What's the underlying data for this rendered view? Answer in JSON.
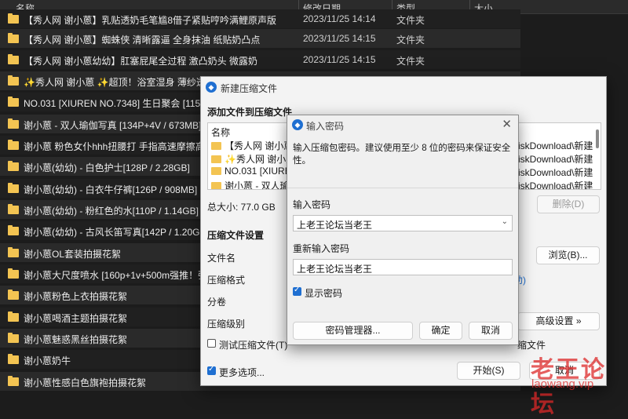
{
  "list_header": {
    "name": "名称",
    "date": "修改日期",
    "type": "类型",
    "size": "大小"
  },
  "files": [
    {
      "name": "【秀人网 谢小蒽】乳贴透奶毛笔尴8借子紧贴哼吟满鲤原声版",
      "date": "2023/11/25 14:14",
      "type": "文件夹"
    },
    {
      "name": "【秀人网 谢小蒽】蜘蛛侠 清晰露逼 全身抹油 纸贴奶凸点",
      "date": "2023/11/25 14:15",
      "type": "文件夹"
    },
    {
      "name": "【秀人网 谢小蒽幼幼】肛塞屁尾全过程 激凸奶头 微露奶",
      "date": "2023/11/25 14:15",
      "type": "文件夹"
    },
    {
      "name": "✨秀人网 谢小蒽 ✨超顶！浴室湿身 薄纱透点 勒出",
      "date": "",
      "type": ""
    },
    {
      "name": "NO.031 [XIUREN NO.7348] 生日聚会 [115P+4V]",
      "date": "",
      "type": ""
    },
    {
      "name": "谢小蒽 - 双人瑜伽写真 [134P+4V / 673MB]",
      "date": "",
      "type": ""
    },
    {
      "name": "谢小蒽 粉色女仆hhh扭腰打 手指高速摩擦高潮喷水 [3",
      "date": "",
      "type": ""
    },
    {
      "name": "谢小蒽(幼幼) - 白色护士[128P / 2.28GB]",
      "date": "",
      "type": ""
    },
    {
      "name": "谢小蒽(幼幼) - 白衣牛仔裤[126P / 908MB]",
      "date": "",
      "type": ""
    },
    {
      "name": "谢小蒽(幼幼) - 粉红色的水[110P / 1.14GB]",
      "date": "",
      "type": ""
    },
    {
      "name": "谢小蒽(幼幼) - 古风长笛写真[142P / 1.20GB]",
      "date": "",
      "type": ""
    },
    {
      "name": "谢小蒽OL套装拍摄花絮",
      "date": "",
      "type": ""
    },
    {
      "name": "谢小蒽大尺度喷水 [160p+1v+500m强推！强推！",
      "date": "",
      "type": ""
    },
    {
      "name": "谢小蒽粉色上衣拍摄花絮",
      "date": "",
      "type": ""
    },
    {
      "name": "谢小蒽喝酒主题拍摄花絮",
      "date": "",
      "type": ""
    },
    {
      "name": "谢小蒽魅惑黑丝拍摄花絮",
      "date": "",
      "type": ""
    },
    {
      "name": "谢小蒽奶牛",
      "date": "",
      "type": ""
    },
    {
      "name": "谢小蒽性感白色旗袍拍摄花絮",
      "date": "",
      "type": ""
    }
  ],
  "archive_dialog": {
    "title": "新建压缩文件",
    "add_section": "添加文件到压缩文件",
    "col_name": "名称",
    "items": [
      {
        "name": "【秀人网 谢小蒽幼",
        "path": "iskDownload\\新建"
      },
      {
        "name": "✨秀人网 谢小蒽 ✨",
        "path": "iskDownload\\新建"
      },
      {
        "name": "NO.031 [XIUREN I",
        "path": "iskDownload\\新建"
      },
      {
        "name": "谢小蒽 - 双人瑜",
        "path": "iskDownload\\新建"
      }
    ],
    "total_size": "总大小: 77.0 GB",
    "delete_label": "删除(D)",
    "settings_section": "压缩文件设置",
    "filename_label": "文件名",
    "browse_label": "浏览(B)...",
    "format_label": "压缩格式",
    "format_link_fragment": "助)",
    "split_label": "分卷",
    "level_label": "压缩级别",
    "advanced_label": "高级设置 »",
    "test_label": "测试压缩文件(T)",
    "right_fragment": "缩文件",
    "more_options_label": "更多选项...",
    "start_label": "开始(S)",
    "cancel_label": "取消"
  },
  "password_dialog": {
    "title": "输入密码",
    "description": "输入压缩包密码。建议使用至少 8 位的密码来保证安全性。",
    "enter_label": "输入密码",
    "password_value": "上老王论坛当老王",
    "reenter_label": "重新输入密码",
    "reenter_value": "上老王论坛当老王",
    "show_password_label": "显示密码",
    "show_password_checked": true,
    "manager_label": "密码管理器...",
    "ok_label": "确定",
    "cancel_label": "取消"
  },
  "watermark": {
    "cn": "老王论坛",
    "en": "laowang.vip"
  }
}
